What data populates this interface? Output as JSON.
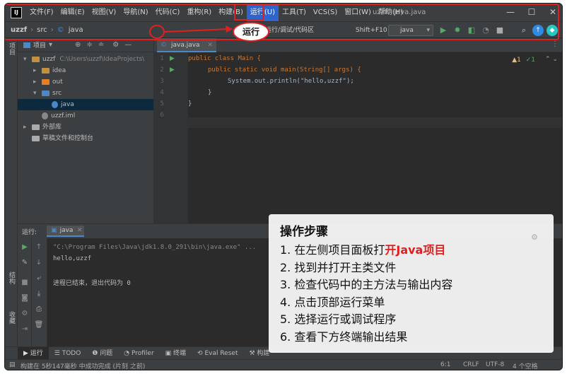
{
  "colors": {
    "accent": "#2f65ca",
    "annotation_red": "#e02020",
    "keyword": "#cc7832",
    "run_green": "#59a869",
    "debug_green": "#499c54"
  },
  "menubar": {
    "logo": "IJ",
    "items": [
      "文件(F)",
      "编辑(E)",
      "视图(V)",
      "导航(N)",
      "代码(C)",
      "重构(R)",
      "构建(B)",
      "运行(U)",
      "工具(T)",
      "VCS(S)",
      "窗口(W)",
      "帮助(H)"
    ],
    "active_item": "运行(U)",
    "window_title": "uzzf - java.java",
    "minimize": "—",
    "maximize": "☐",
    "close": "✕"
  },
  "callout": {
    "label": "运行"
  },
  "navbar": {
    "breadcrumbs": [
      "uzzf",
      "src",
      "java"
    ],
    "run_hint": "运行/调试/代码区",
    "shortcut": "Shift+F10",
    "run_config": "java",
    "icons": [
      "hammer-icon",
      "run-icon",
      "debug-icon",
      "coverage-icon",
      "profile-icon",
      "stop-icon",
      "search-icon",
      "update-icon",
      "plugin-icon"
    ]
  },
  "leftstripe": {
    "top_label": "项目",
    "bottom_labels": [
      "结构",
      "收藏"
    ]
  },
  "project": {
    "title": "项目",
    "tree": [
      {
        "label": "uzzf",
        "path": "C:\\Users\\uzzf\\IdeaProjects\\",
        "color": "#c3903e",
        "indent": 1,
        "arrow": "▾"
      },
      {
        "label": "idea",
        "color": "#c3903e",
        "indent": 2,
        "arrow": "▸"
      },
      {
        "label": "out",
        "color": "#e67e22",
        "indent": 2,
        "arrow": "▸"
      },
      {
        "label": "src",
        "color": "#4a88c7",
        "indent": 2,
        "arrow": "▾"
      },
      {
        "label": "java",
        "color": "#4a88c7",
        "indent": 3,
        "arrow": "",
        "selected": true,
        "file": true
      },
      {
        "label": "uzzf.iml",
        "color": "#888888",
        "indent": 2,
        "arrow": "",
        "file": true
      },
      {
        "label": "外部库",
        "color": "#aaaaaa",
        "indent": 1,
        "arrow": "▸"
      },
      {
        "label": "草稿文件和控制台",
        "color": "#aaaaaa",
        "indent": 1,
        "arrow": ""
      }
    ]
  },
  "editor": {
    "tab": "java.java",
    "line_numbers": [
      "1",
      "2",
      "3",
      "4",
      "5",
      "6"
    ],
    "code": [
      {
        "text": "public class Main {",
        "indent": 0,
        "color": "#cc7832"
      },
      {
        "text": "public static void main(String[] args) {",
        "indent": 2,
        "color": "#cc7832"
      },
      {
        "text": "System.out.println(\"hello,uzzf\");",
        "indent": 4,
        "color": "#a9b7c6"
      },
      {
        "text": "}",
        "indent": 2,
        "color": "#a9b7c6"
      },
      {
        "text": "}",
        "indent": 0,
        "color": "#a9b7c6"
      }
    ],
    "inspections": {
      "warnings": "1",
      "ok": "1"
    }
  },
  "run": {
    "label": "运行:",
    "tab": "java",
    "output": [
      "\"C:\\Program Files\\Java\\jdk1.8.0_291\\bin\\java.exe\" ...",
      "hello,uzzf",
      "",
      "进程已结束，退出代码为 0"
    ]
  },
  "bottomtabs": [
    "▶ 运行",
    "☰ TODO",
    "❶ 问题",
    "◔ Profiler",
    "▣ 终端",
    "⟲ Eval Reset",
    "⚒ 构建"
  ],
  "status": {
    "left": "构建在 5秒147毫秒 中成功完成 (片刻 之前)",
    "position": "6:1",
    "line_ending": "CRLF",
    "encoding": "UTF-8",
    "indent": "4 个空格"
  },
  "steps": {
    "title": "操作步骤",
    "items": [
      {
        "text": "1. 在左侧项目面板打",
        "highlight": "开Java项目"
      },
      {
        "text": "2. 找到并打开主类文件",
        "highlight": ""
      },
      {
        "text": "3. 检查代码中的主方法与输出内容",
        "highlight": ""
      },
      {
        "text": "4. 点击顶部运行菜单",
        "highlight": ""
      },
      {
        "text": "5. 选择运行或调试程序",
        "highlight": ""
      },
      {
        "text": "6. 查看下方终端输出结果",
        "highlight": ""
      }
    ]
  }
}
